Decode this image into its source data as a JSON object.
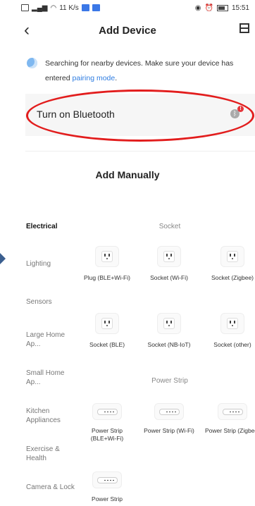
{
  "status_bar": {
    "network": "11 K/s",
    "time": "15:51"
  },
  "header": {
    "title": "Add Device",
    "back_icon": "chevron-left-icon",
    "scan_icon": "scan-icon"
  },
  "search": {
    "text": "Searching for nearby devices. Make sure your device has entered ",
    "link": "pairing mode",
    "suffix": "."
  },
  "bluetooth": {
    "label": "Turn on Bluetooth",
    "badge": "!",
    "icon": "bluetooth-icon"
  },
  "highlight_color": "#e21d1d",
  "manual": {
    "title": "Add Manually"
  },
  "sidebar": {
    "items": [
      {
        "label": "Electrical",
        "active": true
      },
      {
        "label": "Lighting"
      },
      {
        "label": "Sensors"
      },
      {
        "label": "Large Home Ap..."
      },
      {
        "label": "Small Home Ap..."
      },
      {
        "label": "Kitchen Appliances"
      },
      {
        "label": "Exercise & Health"
      },
      {
        "label": "Camera & Lock"
      }
    ]
  },
  "sections": {
    "socket": {
      "title": "Socket",
      "devices": [
        {
          "label": "Plug (BLE+Wi-Fi)"
        },
        {
          "label": "Socket (Wi-Fi)"
        },
        {
          "label": "Socket (Zigbee)"
        },
        {
          "label": "Socket (BLE)"
        },
        {
          "label": "Socket (NB-IoT)"
        },
        {
          "label": "Socket (other)"
        }
      ]
    },
    "power_strip": {
      "title": "Power Strip",
      "devices": [
        {
          "label": "Power Strip (BLE+Wi-Fi)"
        },
        {
          "label": "Power Strip (Wi-Fi)"
        },
        {
          "label": "Power Strip (Zigbee)"
        },
        {
          "label": "Power Strip"
        }
      ]
    }
  }
}
